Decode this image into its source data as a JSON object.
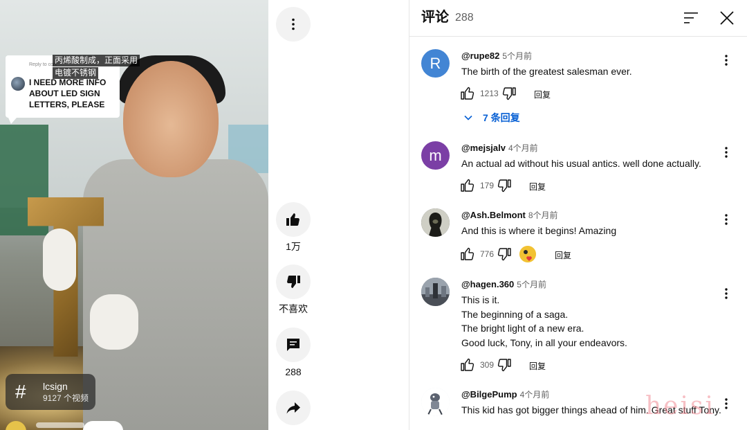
{
  "video": {
    "reply_to_label": "Reply to comment",
    "reply_text": "I NEED MORE INFO ABOUT LED SIGN LETTERS, PLEASE",
    "caption_line1": "丙烯酸制成，正面采用",
    "caption_line2": "电镀不锈钢",
    "hashtag": {
      "name": "lcsign",
      "count": "9127 个视频"
    }
  },
  "rail": {
    "like_count": "1万",
    "dislike_label": "不喜欢",
    "comment_count": "288"
  },
  "comments_panel": {
    "title": "评论",
    "count": "288",
    "comments": [
      {
        "author": "@rupe82",
        "time": "5个月前",
        "avatar_letter": "R",
        "avatar_color": "#4285d4",
        "body": "The birth of the greatest salesman ever.",
        "likes": "1213",
        "reply_label": "回复",
        "replies_label": "7 条回复"
      },
      {
        "author": "@mejsjalv",
        "time": "4个月前",
        "avatar_letter": "m",
        "avatar_color": "#7b3fa5",
        "body": "An actual ad without his usual antics. well done actually.",
        "likes": "179",
        "reply_label": "回复"
      },
      {
        "author": "@Ash.Belmont",
        "time": "8个月前",
        "avatar_letter": "",
        "avatar_color": "#3a3a34",
        "body": "And this is where it begins! Amazing",
        "likes": "776",
        "reply_label": "回复"
      },
      {
        "author": "@hagen.360",
        "time": "5个月前",
        "avatar_letter": "",
        "avatar_color": "#5b6270",
        "body": "This is it.\nThe beginning of a saga.\nThe bright light of a new era.\nGood luck, Tony, in all your endeavors.",
        "likes": "309",
        "reply_label": "回复"
      },
      {
        "author": "@BilgePump",
        "time": "4个月前",
        "avatar_letter": "",
        "avatar_color": "#dfe3e8",
        "body": "This kid has got bigger things ahead of him. Great stuff Tony.",
        "likes": "",
        "reply_label": ""
      }
    ]
  },
  "watermark": "heisi",
  "colors": {
    "link_blue": "#065fd4",
    "text": "#0f0f0f",
    "secondary": "#606060"
  }
}
